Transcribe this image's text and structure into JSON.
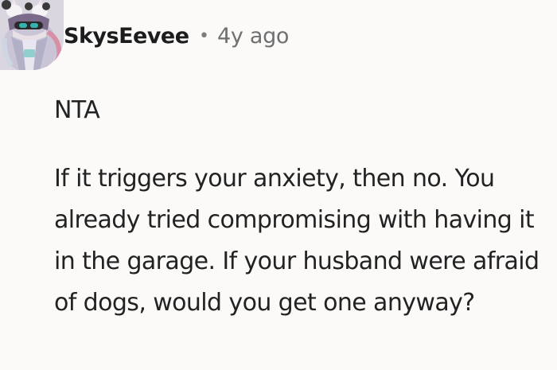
{
  "comment": {
    "author": "SkysEevee",
    "separator": "•",
    "timestamp": "4y ago",
    "avatar_icon": "avatar-icon",
    "paragraphs": [
      "NTA",
      "If it triggers your anxiety, then no. You already tried compromising with having it in the garage. If your husband were afraid of dogs, would you get one anyway?"
    ]
  },
  "colors": {
    "background": "#fbfaf9",
    "text": "#1c1c1c",
    "muted": "#6f6f6f"
  }
}
